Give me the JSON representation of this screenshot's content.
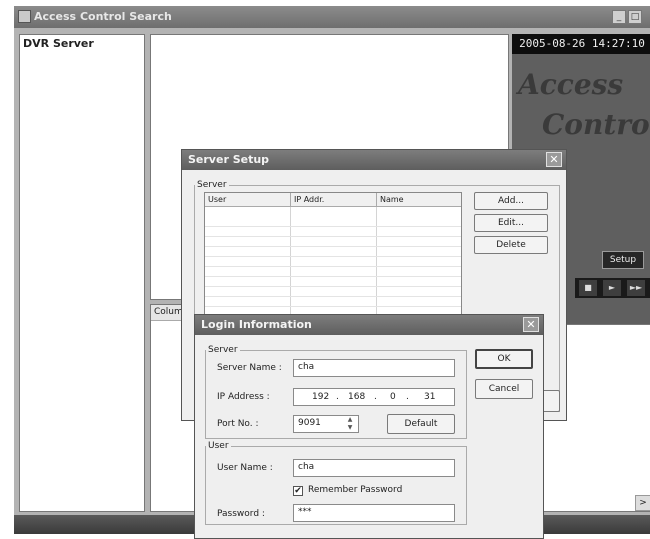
{
  "main_window": {
    "title": "Access Control Search",
    "dvr_panel_label": "DVR Server",
    "column_header": "Colum",
    "datetime": "2005-08-26 14:27:10",
    "brand_line1": "Access",
    "brand_line2": "Control",
    "setup_label": "Setup",
    "media_buttons": [
      "■",
      "►",
      "►►"
    ]
  },
  "server_setup": {
    "title": "Server Setup",
    "group_label": "Server",
    "columns": [
      "User",
      "IP Addr.",
      "Name"
    ],
    "buttons": {
      "add": "Add...",
      "edit": "Edit...",
      "delete": "Delete"
    }
  },
  "login_info": {
    "title": "Login Information",
    "server_group": "Server",
    "server_name_label": "Server Name :",
    "server_name_value": "cha",
    "ip_label": "IP Address :",
    "ip_parts": [
      "192",
      "168",
      "0",
      "31"
    ],
    "port_label": "Port No. :",
    "port_value": "9091",
    "default_label": "Default",
    "user_group": "User",
    "user_name_label": "User Name :",
    "user_name_value": "cha",
    "remember_label": "Remember Password",
    "remember_checked": true,
    "password_label": "Password :",
    "password_value": "***",
    "ok_label": "OK",
    "cancel_label": "Cancel"
  },
  "icons": {
    "close": "close-icon",
    "minimize": "minimize-icon",
    "maximize": "maximize-icon"
  }
}
